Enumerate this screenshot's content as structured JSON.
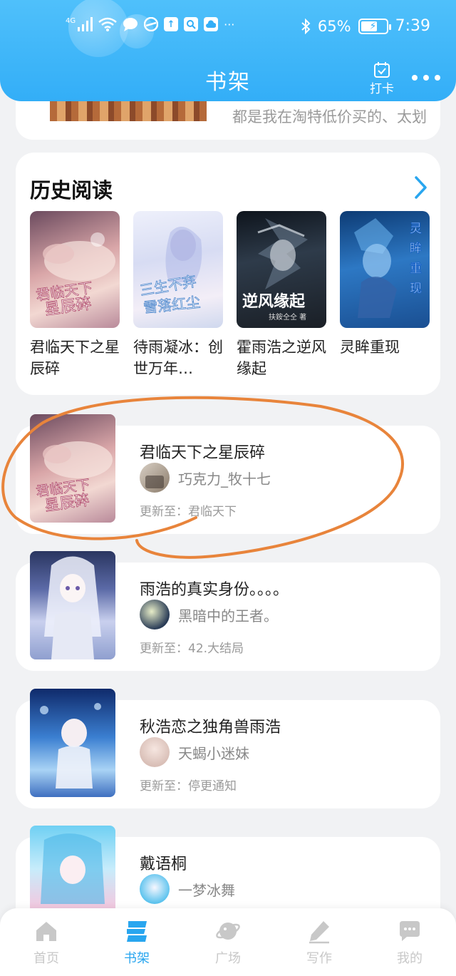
{
  "status_bar": {
    "network": "4G",
    "battery_percent": "65%",
    "battery_level": 0.65,
    "time": "7:39",
    "more": "···"
  },
  "header": {
    "title": "书架",
    "checkin_label": "打卡"
  },
  "peek_card": {
    "snippet": "都是我在淘特低价买的、太划"
  },
  "history": {
    "title": "历史阅读",
    "items": [
      {
        "name": "君临天下之星辰碎",
        "cover_text": "君临天下之星辰碎"
      },
      {
        "name": "待雨凝冰：创世万年…",
        "cover_text": "三生不弃雪落红尘"
      },
      {
        "name": "霍雨浩之逆风缘起",
        "cover_text": "逆风缘起"
      },
      {
        "name": "灵眸重现",
        "cover_text": "灵眸重现"
      }
    ]
  },
  "books": [
    {
      "title": "君临天下之星辰碎",
      "author": "巧克力_牧十七",
      "update": "更新至：君临天下"
    },
    {
      "title": "雨浩的真实身份。。。。",
      "author": "黑暗中的王者。",
      "update": "更新至：42.大结局"
    },
    {
      "title": "秋浩恋之独角兽雨浩",
      "author": "天蝎小迷妹",
      "update": "更新至：停更通知"
    },
    {
      "title": "戴语桐",
      "author": "一梦冰舞",
      "update": ""
    }
  ],
  "nav": [
    {
      "label": "首页",
      "icon": "home-icon"
    },
    {
      "label": "书架",
      "icon": "bookshelf-icon"
    },
    {
      "label": "广场",
      "icon": "planet-icon"
    },
    {
      "label": "写作",
      "icon": "pen-icon"
    },
    {
      "label": "我的",
      "icon": "chat-icon"
    }
  ],
  "colors": {
    "header": "#33aef7",
    "accent": "#29a6ef",
    "highlight": "#e8843b",
    "background": "#f1f2f4"
  }
}
